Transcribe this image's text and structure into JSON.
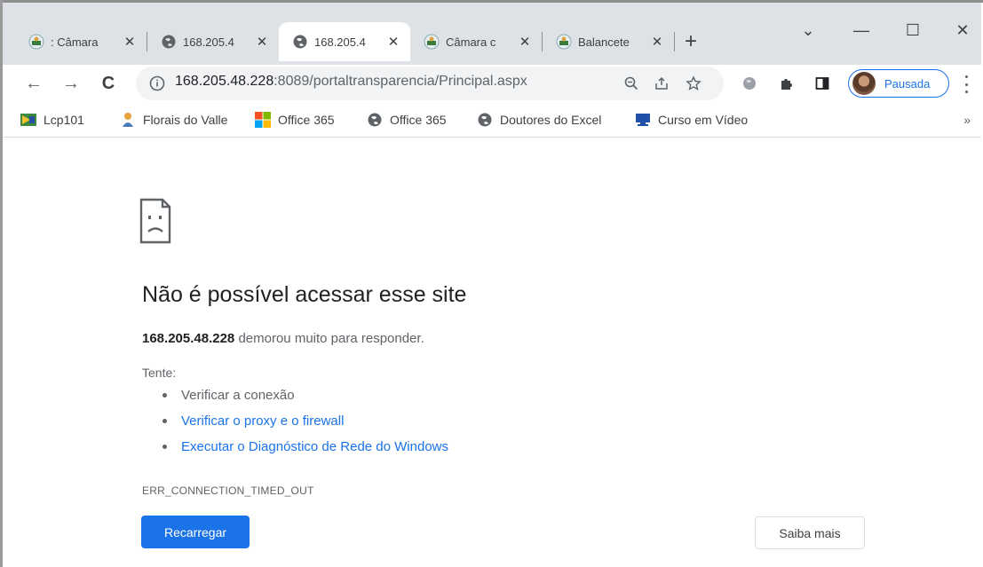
{
  "tabs": [
    {
      "title": ": Câmara",
      "favicon": "camara-favicon",
      "active": false
    },
    {
      "title": "168.205.4",
      "favicon": "globe-icon",
      "active": false
    },
    {
      "title": "168.205.4",
      "favicon": "globe-icon",
      "active": true
    },
    {
      "title": "Câmara c",
      "favicon": "camara-favicon",
      "active": false
    },
    {
      "title": "Balancete",
      "favicon": "camara-favicon",
      "active": false
    }
  ],
  "tab_close_glyph": "✕",
  "new_tab_glyph": "+",
  "window_controls": {
    "tabsearch": "⌄",
    "minimize": "—",
    "maximize": "☐",
    "close": "✕"
  },
  "toolbar": {
    "back": "←",
    "forward": "→",
    "reload": "C",
    "url_host": "168.205.48.228",
    "url_rest": ":8089/portaltransparencia/Principal.aspx",
    "profile_label": "Pausada"
  },
  "bookmarks": [
    {
      "label": "Lcp101",
      "icon": "lcp-icon"
    },
    {
      "label": "Florais do Valle",
      "icon": "florais-icon"
    },
    {
      "label": "Office 365",
      "icon": "microsoft-icon"
    },
    {
      "label": "Office 365",
      "icon": "globe-icon"
    },
    {
      "label": "Doutores do Excel",
      "icon": "globe-icon"
    },
    {
      "label": "Curso em Vídeo",
      "icon": "monitor-icon"
    }
  ],
  "bookmarks_more": "»",
  "error": {
    "title": "Não é possível acessar esse site",
    "host": "168.205.48.228",
    "desc_rest": " demorou muito para responder.",
    "try_label": "Tente:",
    "suggestions": [
      {
        "text": "Verificar a conexão",
        "link": false
      },
      {
        "text": "Verificar o proxy e o firewall",
        "link": true
      },
      {
        "text": "Executar o Diagnóstico de Rede do Windows",
        "link": true
      }
    ],
    "code": "ERR_CONNECTION_TIMED_OUT",
    "reload_label": "Recarregar",
    "learn_more_label": "Saiba mais"
  },
  "colors": {
    "accent": "#1a73e8",
    "tabstrip": "#dee1e6",
    "omnibox": "#f1f3f4"
  }
}
